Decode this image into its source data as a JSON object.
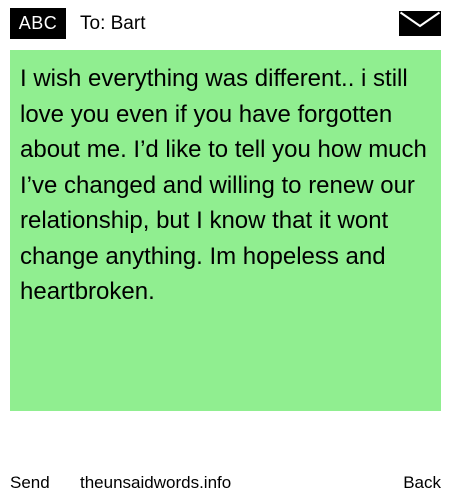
{
  "header": {
    "input_mode": "ABC",
    "recipient": "To: Bart",
    "icon": "envelope-icon"
  },
  "message": {
    "body": "I wish everything was different.. i still love you even if you have forgotten about me. I’d like to tell you how much I’ve changed and willing to renew our relationship, but I know that it wont change anything. Im hopeless and heartbroken."
  },
  "softkeys": {
    "left": "Send",
    "center": "theunsaidwords.info",
    "right": "Back"
  },
  "colors": {
    "message_background": "#90ee90",
    "badge_background": "#000000"
  }
}
